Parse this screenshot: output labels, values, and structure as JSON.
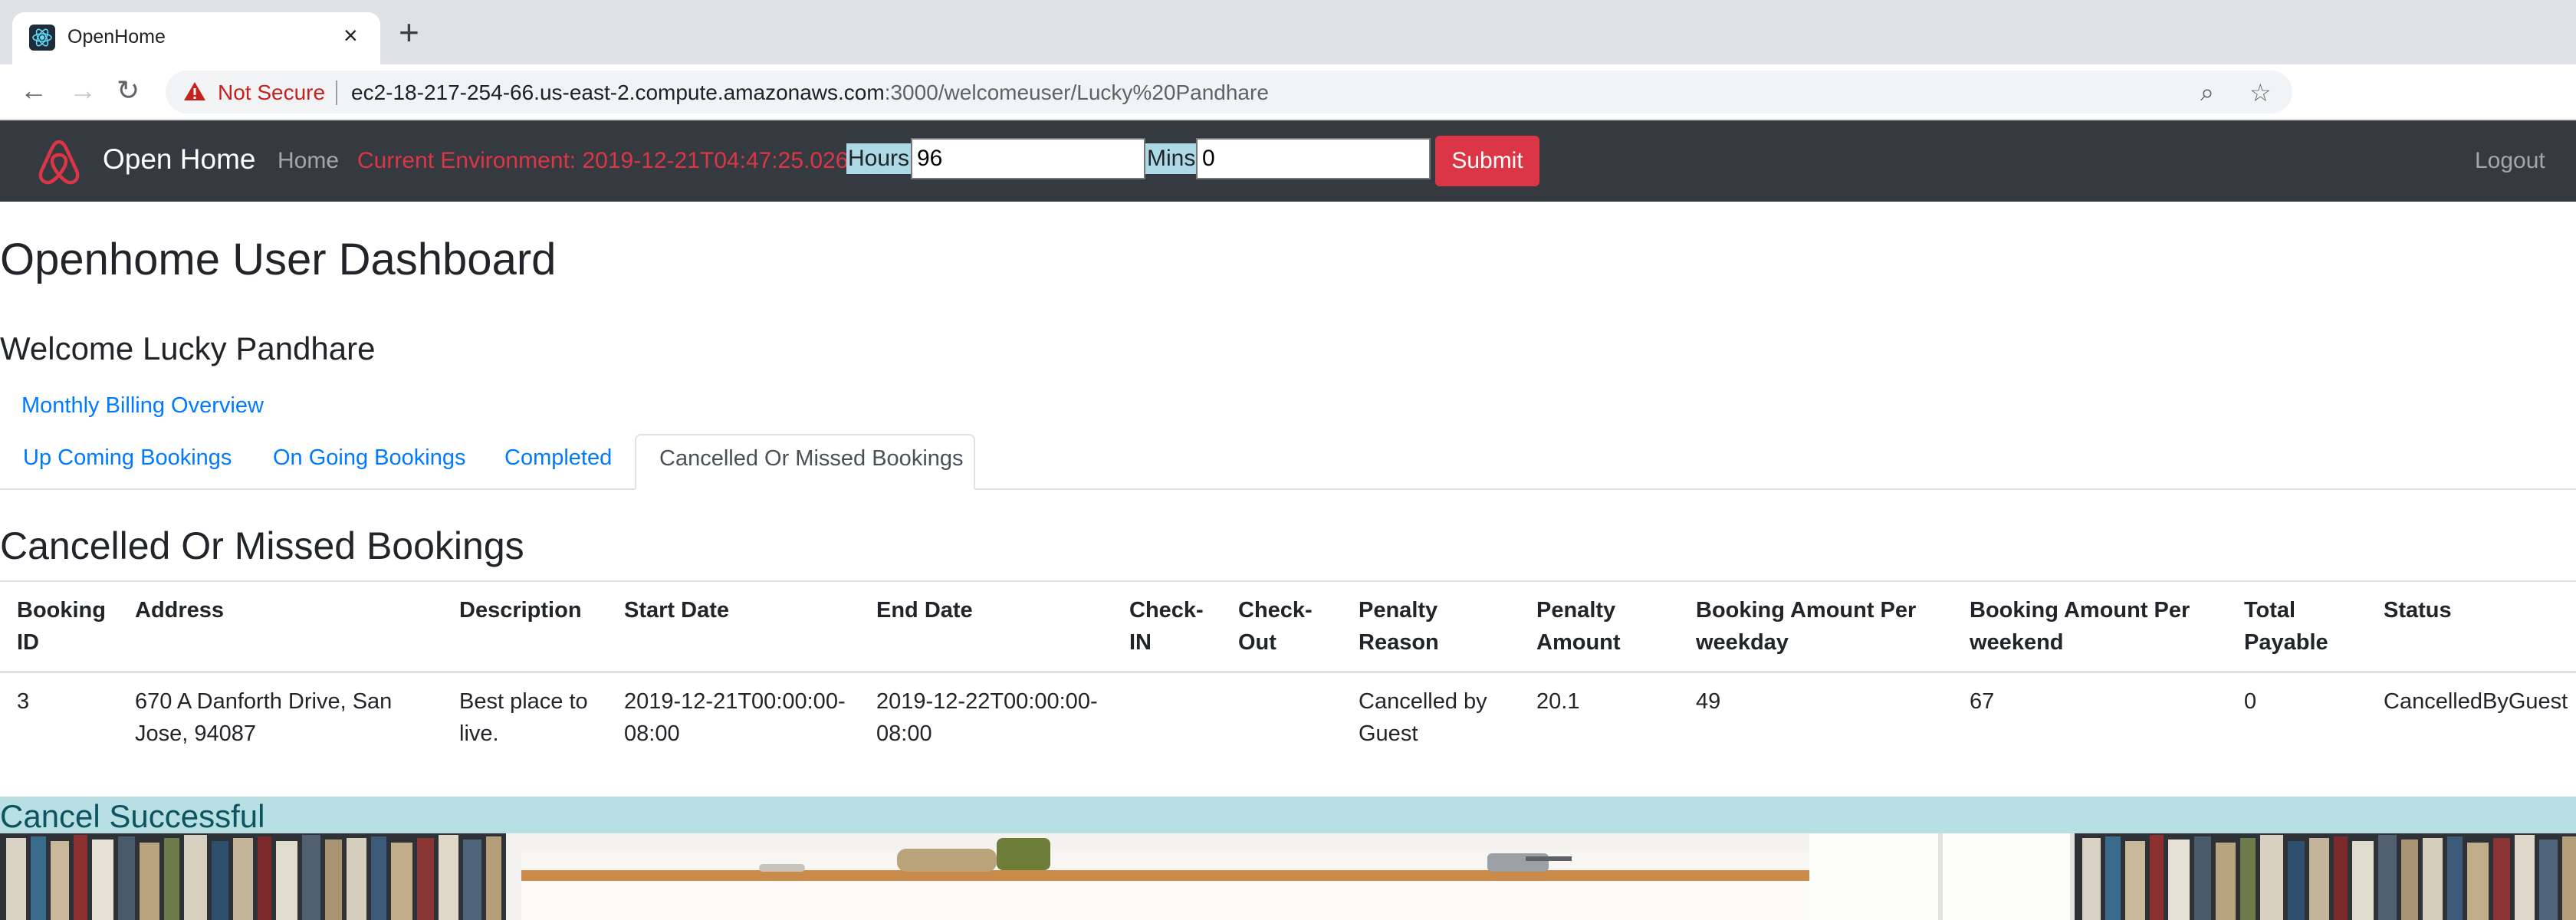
{
  "browser": {
    "tab_title": "OpenHome",
    "url_host": "ec2-18-217-254-66.us-east-2.compute.amazonaws.com",
    "url_path": ":3000/welcomeuser/Lucky%20Pandhare",
    "security_label": "Not Secure"
  },
  "navbar": {
    "brand": "Open Home",
    "home": "Home",
    "environment": "Current Environment: 2019-12-21T04:47:25.026Z",
    "hours_label": "Hours:",
    "hours_value": "96",
    "mins_label": "Mins:",
    "mins_value": "0",
    "submit": "Submit",
    "logout": "Logout"
  },
  "page": {
    "title": "Openhome User Dashboard",
    "welcome": "Welcome Lucky Pandhare",
    "billing_link": "Monthly Billing Overview",
    "tabs": [
      {
        "label": "Up Coming Bookings"
      },
      {
        "label": "On Going Bookings"
      },
      {
        "label": "Completed"
      },
      {
        "label": "Cancelled Or Missed Bookings"
      }
    ],
    "section_title": "Cancelled Or Missed Bookings",
    "alert": "Cancel Successful"
  },
  "table": {
    "headers": [
      "Booking ID",
      "Address",
      "Description",
      "Start Date",
      "End Date",
      "Check-IN",
      "Check-Out",
      "Penalty Reason",
      "Penalty Amount",
      "Booking Amount Per weekday",
      "Booking Amount Per weekend",
      "Total Payable",
      "Status"
    ],
    "rows": [
      [
        "3",
        "670 A Danforth Drive, San Jose, 94087",
        "Best place to live.",
        "2019-12-21T00:00:00-08:00",
        "2019-12-22T00:00:00-08:00",
        "",
        "",
        "Cancelled by Guest",
        "20.1",
        "49",
        "67",
        "0",
        "CancelledByGuest"
      ]
    ]
  },
  "colors": {
    "navbar_bg": "#343a40",
    "link": "#007bff",
    "danger": "#dc3545",
    "alert_bg": "#b8dfe4"
  }
}
